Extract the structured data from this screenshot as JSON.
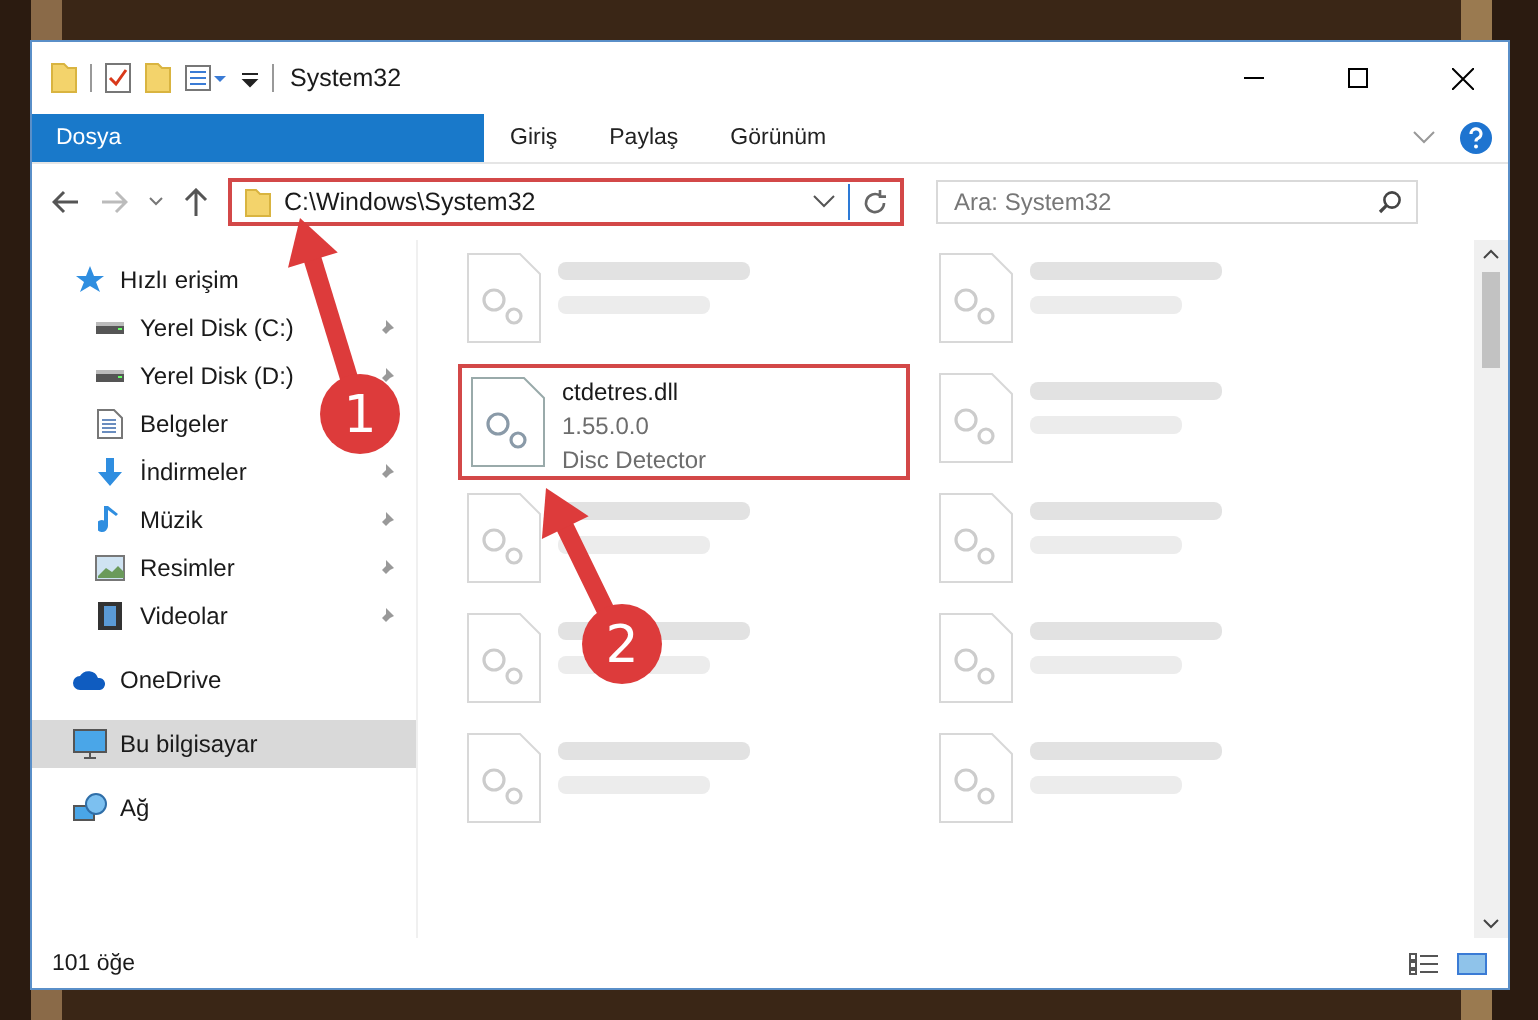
{
  "window": {
    "title": "System32"
  },
  "ribbon_tabs": [
    {
      "label": "Dosya",
      "kind": "file"
    },
    {
      "label": "Giriş",
      "kind": "tab"
    },
    {
      "label": "Paylaş",
      "kind": "tab"
    },
    {
      "label": "Görünüm",
      "kind": "tab"
    }
  ],
  "address_bar": {
    "path": "C:\\Windows\\System32",
    "highlighted": true
  },
  "search": {
    "placeholder": "Ara: System32"
  },
  "sidebar": {
    "items": [
      {
        "label": "Hızlı erişim",
        "kind": "star",
        "selected": false,
        "children": [
          {
            "label": "Yerel Disk (C:)",
            "kind": "drive",
            "pinned": true
          },
          {
            "label": "Yerel Disk (D:)",
            "kind": "drive",
            "pinned": true
          },
          {
            "label": "Belgeler",
            "kind": "document",
            "pinned": false
          },
          {
            "label": "İndirmeler",
            "kind": "download",
            "pinned": true
          },
          {
            "label": "Müzik",
            "kind": "music",
            "pinned": true
          },
          {
            "label": "Resimler",
            "kind": "picture",
            "pinned": true
          },
          {
            "label": "Videolar",
            "kind": "film",
            "pinned": true
          }
        ]
      },
      {
        "label": "OneDrive",
        "kind": "cloud",
        "selected": false
      },
      {
        "label": "Bu bilgisayar",
        "kind": "computer",
        "selected": true
      },
      {
        "label": "Ağ",
        "kind": "network",
        "selected": false
      }
    ]
  },
  "files": [
    {
      "blurred": true,
      "highlighted": false
    },
    {
      "blurred": true,
      "highlighted": false
    },
    {
      "name": "ctdetres.dll",
      "lines": [
        "1.55.0.0",
        "Disc Detector"
      ],
      "blurred": false,
      "highlighted": true
    },
    {
      "blurred": true,
      "highlighted": false
    },
    {
      "blurred": true,
      "highlighted": false
    },
    {
      "blurred": true,
      "highlighted": false
    },
    {
      "blurred": true,
      "highlighted": false
    },
    {
      "blurred": true,
      "highlighted": false
    },
    {
      "blurred": true,
      "highlighted": false
    },
    {
      "blurred": true,
      "highlighted": false
    }
  ],
  "status_bar": {
    "count": "101 öğe"
  },
  "callouts": [
    {
      "label": "1"
    },
    {
      "label": "2"
    }
  ]
}
